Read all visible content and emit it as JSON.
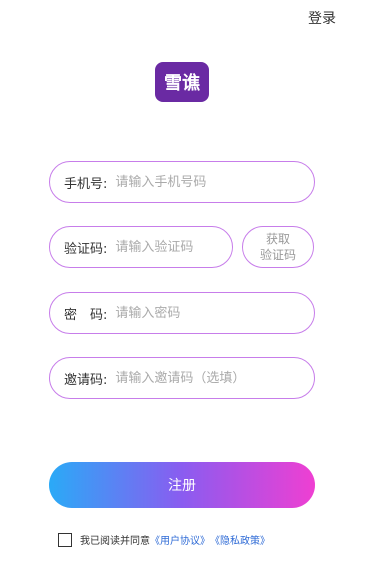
{
  "header": {
    "login_label": "登录"
  },
  "logo": {
    "text": "雪谯",
    "subtext": ""
  },
  "form": {
    "phone": {
      "label": "手机号:",
      "placeholder": "请输入手机号码"
    },
    "code": {
      "label": "验证码:",
      "placeholder": "请输入验证码",
      "get_code_label": "获取\n验证码"
    },
    "password": {
      "label": "密　码:",
      "placeholder": "请输入密码"
    },
    "invite": {
      "label": "邀请码:",
      "placeholder": "请输入邀请码（选填）"
    }
  },
  "actions": {
    "register_label": "注册"
  },
  "agreement": {
    "prefix": "我已阅读并同意",
    "user_agreement": "《用户协议》",
    "privacy_policy": "《隐私政策》"
  },
  "colors": {
    "accent_border": "#c77dea",
    "gradient_start": "#2aaaf7",
    "gradient_end": "#ef3fd2",
    "link": "#2f6bd6",
    "logo_bg": "#6a2aa3"
  }
}
